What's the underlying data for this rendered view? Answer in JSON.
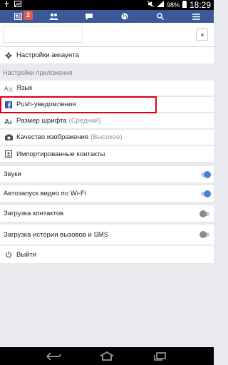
{
  "status_bar": {
    "battery": "98%",
    "time": "18:29"
  },
  "navbar": {
    "badge_count": "2"
  },
  "menu": {
    "account_settings": "Настройки аккаунта",
    "app_settings_header": "Настройки приложения",
    "language": "Язык",
    "push_notifications": "Push-уведомления",
    "font_size": "Размер шрифта",
    "font_size_value": "(Средний)",
    "image_quality": "Качество изображения",
    "image_quality_value": "(Высокое)",
    "imported_contacts": "Импортированные контакты",
    "sounds": "Звуки",
    "autoplay_wifi": "Автозапуск видео по Wi-Fi",
    "upload_contacts": "Загрузка контактов",
    "upload_call_history": "Загрузка истории вызовов и SMS",
    "logout": "Выйти"
  },
  "toggles": {
    "sounds": true,
    "autoplay_wifi": true,
    "upload_contacts": false,
    "upload_call_history": false
  },
  "colors": {
    "facebook_blue": "#3b5998",
    "highlight_red": "#e0001b",
    "toggle_on": "#4a7fe0"
  }
}
